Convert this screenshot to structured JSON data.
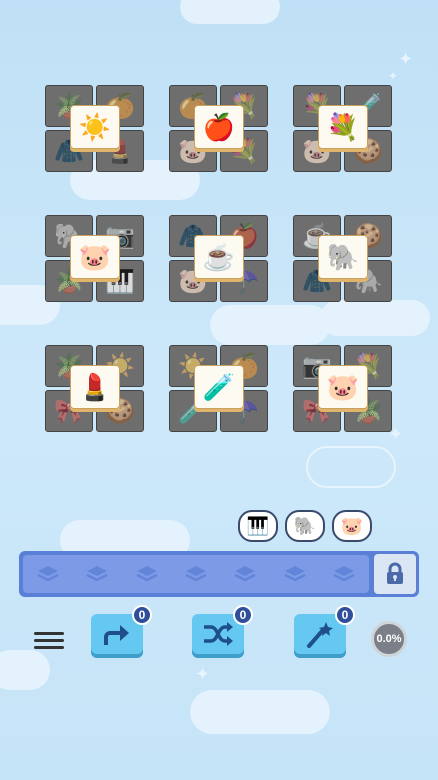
{
  "board": {
    "groups": [
      {
        "top": "sun",
        "corners": [
          "plant",
          "orange",
          "jacket",
          "cosmetics"
        ]
      },
      {
        "top": "apple",
        "corners": [
          "orange",
          "bouquet",
          "pig",
          "bouquet"
        ]
      },
      {
        "top": "bouquet",
        "corners": [
          "bouquet",
          "potion",
          "pig",
          "cookie"
        ]
      },
      {
        "top": "pig",
        "corners": [
          "elephant",
          "camera",
          "plant",
          "piano"
        ]
      },
      {
        "top": "coffee",
        "corners": [
          "jacket",
          "apple",
          "pig",
          "umbrella"
        ]
      },
      {
        "top": "elephant",
        "corners": [
          "coffee",
          "cookie",
          "jacket",
          "elephant"
        ]
      },
      {
        "top": "cosmetics",
        "corners": [
          "plant",
          "sun",
          "bow",
          "cookie"
        ]
      },
      {
        "top": "potion",
        "corners": [
          "sun",
          "orange",
          "potion",
          "umbrella"
        ]
      },
      {
        "top": "pig",
        "corners": [
          "camera",
          "bouquet",
          "bow",
          "plant"
        ]
      }
    ]
  },
  "preview_chips": [
    "piano",
    "elephant",
    "pig"
  ],
  "slot_bar": {
    "slots": 7,
    "lock_icon": "lock-icon"
  },
  "powerups": [
    {
      "name": "undo",
      "count": "0",
      "icon": "undo-arrow-icon"
    },
    {
      "name": "shuffle",
      "count": "0",
      "icon": "shuffle-icon"
    },
    {
      "name": "magic",
      "count": "0",
      "icon": "magic-wand-icon"
    }
  ],
  "progress": {
    "label": "0.0%"
  },
  "colors": {
    "accent": "#64c8f0",
    "slot_bar": "#5a7fd6",
    "badge": "#2f4f9a"
  }
}
